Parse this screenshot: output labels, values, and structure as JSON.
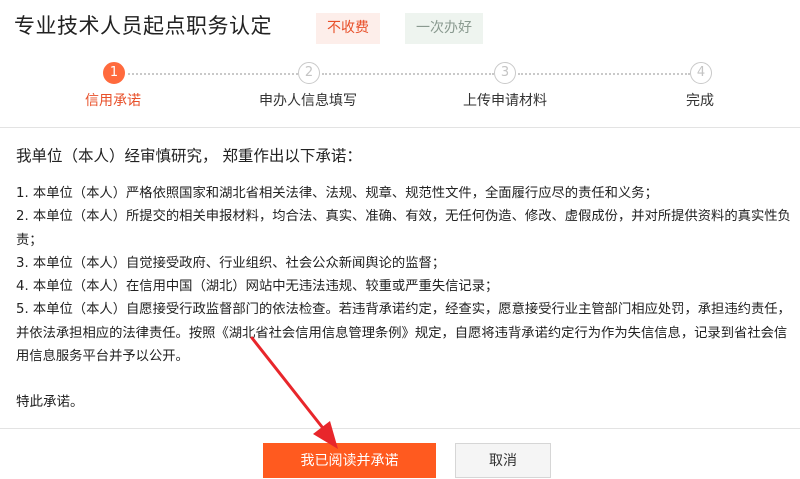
{
  "header": {
    "title": "专业技术人员起点职务认定",
    "badge_free": "不收费",
    "badge_once": "一次办好"
  },
  "steps": [
    {
      "number": "1",
      "label": "信用承诺",
      "active": true
    },
    {
      "number": "2",
      "label": "申办人信息填写",
      "active": false
    },
    {
      "number": "3",
      "label": "上传申请材料",
      "active": false
    },
    {
      "number": "4",
      "label": "完成",
      "active": false
    }
  ],
  "pledge": {
    "intro": "我单位（本人）经审慎研究， 郑重作出以下承诺：",
    "items": [
      "1. 本单位（本人）严格依照国家和湖北省相关法律、法规、规章、规范性文件，全面履行应尽的责任和义务；",
      "2. 本单位（本人）所提交的相关申报材料，均合法、真实、准确、有效，无任何伪造、修改、虚假成份，并对所提供资料的真实性负责；",
      "3. 本单位（本人）自觉接受政府、行业组织、社会公众新闻舆论的监督；",
      "4. 本单位（本人）在信用中国（湖北）网站中无违法违规、较重或严重失信记录；",
      "5. 本单位（本人）自愿接受行政监督部门的依法检查。若违背承诺约定，经查实，愿意接受行业主管部门相应处罚，承担违约责任，并依法承担相应的法律责任。按照《湖北省社会信用信息管理条例》规定，自愿将违背承诺约定行为作为失信信息，记录到省社会信用信息服务平台并予以公开。"
    ],
    "closing": "特此承诺。"
  },
  "buttons": {
    "agree": "我已阅读并承诺",
    "cancel": "取消"
  },
  "colors": {
    "accent": "#ff5a1f",
    "active_step": "#ff6a3d",
    "annotation_arrow": "#e8262b"
  }
}
